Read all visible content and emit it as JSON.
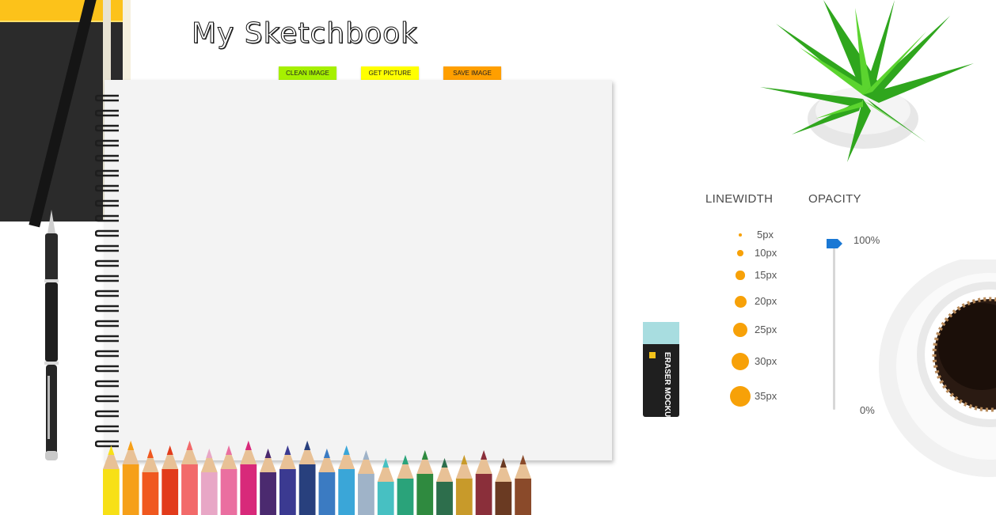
{
  "app": {
    "title": "My Sketchbook"
  },
  "toolbar": {
    "buttons": [
      {
        "label": "CLEAN IMAGE",
        "color": "#a6f000"
      },
      {
        "label": "GET PICTURE",
        "color": "#ffff00"
      },
      {
        "label": "SAVE IMAGE",
        "color": "#ff9f00"
      }
    ]
  },
  "eraser": {
    "text": "ERASER MOCKUP"
  },
  "controls": {
    "linewidth_label": "LINEWIDTH",
    "opacity_label": "OPACITY",
    "linewidths": [
      {
        "label": "5px",
        "size": 5
      },
      {
        "label": "10px",
        "size": 10
      },
      {
        "label": "15px",
        "size": 15
      },
      {
        "label": "20px",
        "size": 20
      },
      {
        "label": "25px",
        "size": 25
      },
      {
        "label": "30px",
        "size": 30
      },
      {
        "label": "35px",
        "size": 35
      }
    ],
    "opacity_max": "100%",
    "opacity_min": "0%",
    "opacity_value": 1.0,
    "accent_color": "#f7a108",
    "slider_color": "#1a78d4"
  },
  "pencil_colors": [
    "#f7e016",
    "#f6a019",
    "#f0581f",
    "#e23b1b",
    "#f26a6a",
    "#e8a7c6",
    "#ea6fa0",
    "#d8297a",
    "#4b2a6f",
    "#3b3a91",
    "#28407d",
    "#3b7bc2",
    "#3aa6d8",
    "#9fb3c8",
    "#47c0c2",
    "#2aa37a",
    "#2f8a3f",
    "#2d6e4c",
    "#c89a2a",
    "#8a2f3a",
    "#6a3a22",
    "#8a4a2a"
  ]
}
